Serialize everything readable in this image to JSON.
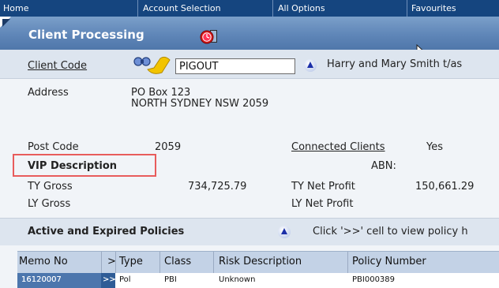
{
  "nav": {
    "home": "Home",
    "account_selection": "Account Selection",
    "all_options": "All Options",
    "favourites": "Favourites"
  },
  "page": {
    "title": "Client Processing"
  },
  "client": {
    "code_label": "Client Code",
    "code_value": "PIGOUT",
    "name": "Harry and Mary Smith t/as"
  },
  "details": {
    "address_label": "Address",
    "address_line1": "PO Box 123",
    "address_line2": "NORTH SYDNEY NSW 2059",
    "postcode_label": "Post Code",
    "postcode_value": "2059",
    "connected_label": "Connected Clients",
    "connected_value": "Yes",
    "vip_label": "VIP Description",
    "abn_label": "ABN:",
    "ty_gross_label": "TY Gross",
    "ty_gross_value": "734,725.79",
    "ty_net_label": "TY Net Profit",
    "ty_net_value": "150,661.29",
    "ly_gross_label": "LY Gross",
    "ly_net_label": "LY Net Profit"
  },
  "policies": {
    "section_label": "Active and Expired Policies",
    "hint": "Click '>>' cell to view policy h",
    "columns": [
      "Memo No",
      ">",
      "Type",
      "Class",
      "Risk Description",
      "Policy Number"
    ],
    "rows": [
      {
        "memo": "16120007",
        "arrow": ">>",
        "type": "Pol",
        "class": "PBI",
        "risk": "Unknown",
        "policy": "PBI000389"
      }
    ]
  },
  "icons": {
    "clock": "alarm-clock-icon",
    "search": "binoculars-icon",
    "expand": "up-triangle-icon",
    "cursor": "mouse-pointer-icon"
  }
}
